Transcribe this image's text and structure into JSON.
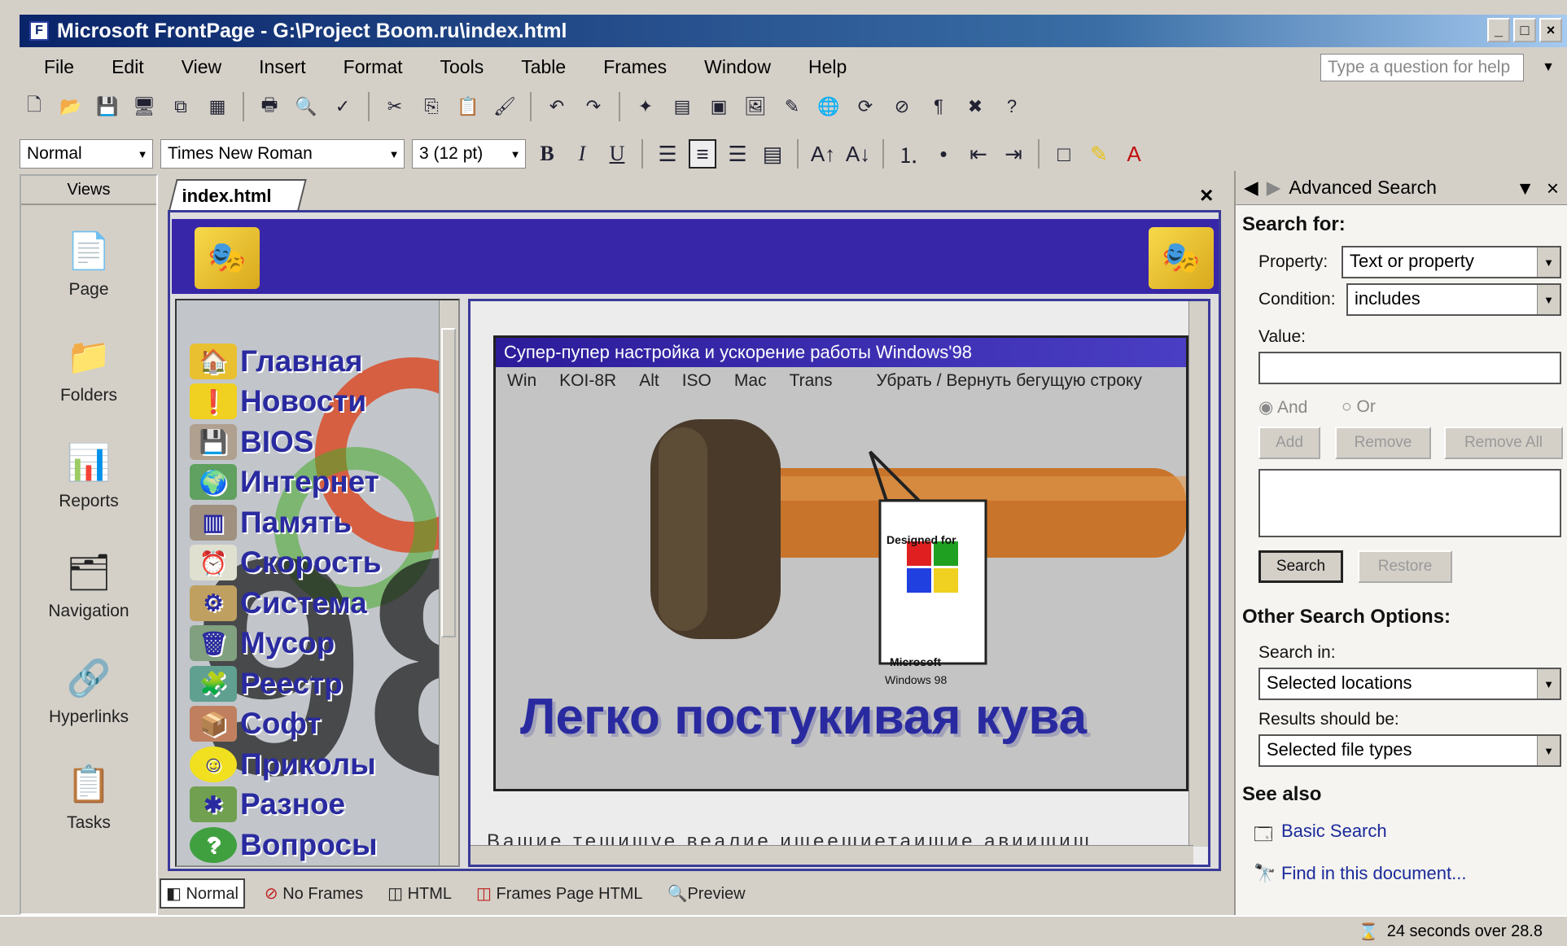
{
  "window": {
    "title": "Microsoft FrontPage - G:\\Project Boom.ru\\index.html",
    "min": "_",
    "max": "□",
    "close": "×"
  },
  "menu": [
    "File",
    "Edit",
    "View",
    "Insert",
    "Format",
    "Tools",
    "Table",
    "Frames",
    "Window",
    "Help"
  ],
  "help_placeholder": "Type a question for help",
  "format_bar": {
    "style": "Normal",
    "font": "Times New Roman",
    "size": "3 (12 pt)",
    "bold": "B",
    "italic": "I",
    "underline": "U",
    "font_color": "A"
  },
  "views": {
    "header": "Views",
    "items": [
      "Page",
      "Folders",
      "Reports",
      "Navigation",
      "Hyperlinks",
      "Tasks"
    ]
  },
  "doc_tab": "index.html",
  "doc_close": "×",
  "site_nav": [
    "Главная",
    "Новости",
    "BIOS",
    "Интернет",
    "Память",
    "Скорость",
    "Система",
    "Мусор",
    "Реестр",
    "Софт",
    "Приколы",
    "Разное",
    "Вопросы"
  ],
  "inner_window": {
    "title": "Супер-пупер настройка и ускорение работы Windows'98",
    "menu": [
      "Win",
      "KOI-8R",
      "Alt",
      "ISO",
      "Mac",
      "Trans",
      "Убрать / Вернуть бегущую строку"
    ],
    "tagline": "Легко постукивая кува",
    "badge": [
      "Designed for",
      "Microsoft",
      "Windows 98"
    ]
  },
  "bottom_marquee": "Вашие тешишуе веалие ишеешиетаишие авиишиш",
  "view_tabs": [
    "Normal",
    "No Frames",
    "HTML",
    "Frames Page HTML",
    "Preview"
  ],
  "task_pane": {
    "title": "Advanced Search",
    "search_for": "Search for:",
    "property_label": "Property:",
    "property_value": "Text or property",
    "condition_label": "Condition:",
    "condition_value": "includes",
    "value_label": "Value:",
    "and_label": "And",
    "or_label": "Or",
    "add_btn": "Add",
    "remove_btn": "Remove",
    "remove_all_btn": "Remove All",
    "search_btn": "Search",
    "restore_btn": "Restore",
    "other_options": "Other Search Options:",
    "search_in_label": "Search in:",
    "search_in_value": "Selected locations",
    "results_label": "Results should be:",
    "results_value": "Selected file types",
    "see_also": "See also",
    "basic_search": "Basic Search",
    "find_in_doc": "Find in this document..."
  },
  "status": "24 seconds over 28.8"
}
